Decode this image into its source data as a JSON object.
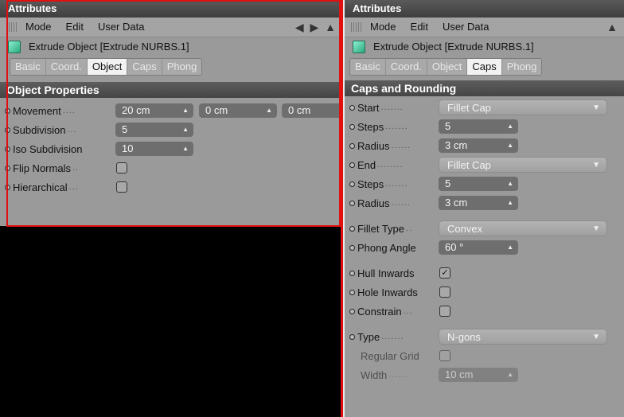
{
  "left": {
    "title": "Attributes",
    "menu": [
      "Mode",
      "Edit",
      "User Data"
    ],
    "nav": "◀ ▶ ▲",
    "object_name": "Extrude Object [Extrude NURBS.1]",
    "tabs": [
      "Basic",
      "Coord.",
      "Object",
      "Caps",
      "Phong"
    ],
    "active_tab": "Object",
    "section": "Object Properties",
    "props": {
      "movement_label": "Movement",
      "movement_x": "20 cm",
      "movement_y": "0 cm",
      "movement_z": "0 cm",
      "subdivision_label": "Subdivision",
      "subdivision_value": "5",
      "iso_label": "Iso Subdivision",
      "iso_value": "10",
      "flip_label": "Flip Normals",
      "hier_label": "Hierarchical"
    }
  },
  "right": {
    "title": "Attributes",
    "menu": [
      "Mode",
      "Edit",
      "User Data"
    ],
    "nav": "▲",
    "object_name": "Extrude Object [Extrude NURBS.1]",
    "tabs": [
      "Basic",
      "Coord.",
      "Object",
      "Caps",
      "Phong"
    ],
    "active_tab": "Caps",
    "section": "Caps and Rounding",
    "props": {
      "start_label": "Start",
      "start_value": "Fillet Cap",
      "steps1_label": "Steps",
      "steps1_value": "5",
      "radius1_label": "Radius",
      "radius1_value": "3 cm",
      "end_label": "End",
      "end_value": "Fillet Cap",
      "steps2_label": "Steps",
      "steps2_value": "5",
      "radius2_label": "Radius",
      "radius2_value": "3 cm",
      "fillet_type_label": "Fillet Type",
      "fillet_type_value": "Convex",
      "phong_label": "Phong Angle",
      "phong_value": "60 °",
      "hull_label": "Hull Inwards",
      "hull_checked": "✓",
      "hole_label": "Hole Inwards",
      "constrain_label": "Constrain",
      "type_label": "Type",
      "type_value": "N-gons",
      "grid_label": "Regular Grid",
      "width_label": "Width",
      "width_value": "10 cm"
    }
  },
  "colors": {
    "highlight": "#e01010",
    "panel": "#9a9a9a",
    "field": "#6e6e6e"
  }
}
